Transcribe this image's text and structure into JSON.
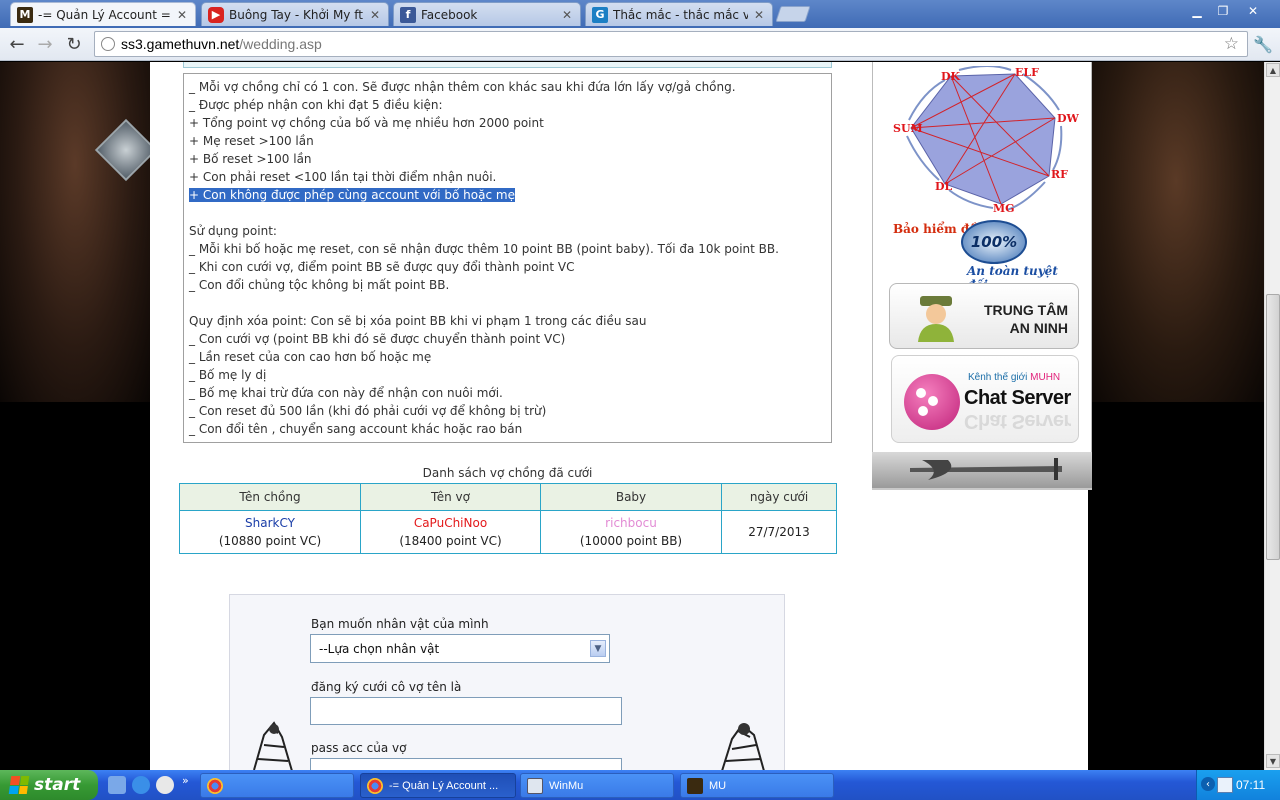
{
  "tabs": [
    {
      "title": "-= Quản Lý Account =-",
      "icon": "mu-game-icon"
    },
    {
      "title": "Buông Tay - Khởi My ft La Thă",
      "icon": "youtube-icon"
    },
    {
      "title": "Facebook",
      "icon": "facebook-icon"
    },
    {
      "title": "Thắc mắc - thắc mắc về poi bé",
      "icon": "gamethu-icon"
    }
  ],
  "toolbar": {
    "url_host": "ss3.gamethuvn.net",
    "url_path": "/wedding.asp"
  },
  "rules": {
    "lines": [
      "_ Mỗi vợ chồng chỉ có 1 con. Sẽ được nhận thêm con khác sau khi đứa lớn lấy vợ/gả chồng.",
      "_ Được phép nhận con khi đạt 5 điều kiện:",
      "+ Tổng point vợ chồng của bố và mẹ nhiều hơn 2000 point",
      "+ Mẹ reset >100 lần",
      "+ Bố reset >100 lần",
      "+ Con phải reset <100 lần tại thời điểm nhận nuôi.",
      "+ Con không được phép cùng account với bố hoặc mẹ",
      "",
      "Sử dụng point:",
      "_ Mỗi khi bố hoặc mẹ reset, con sẽ nhận được thêm 10 point BB (point baby). Tối đa 10k point BB.",
      "_ Khi con cưới vợ, điểm point BB sẽ được quy đổi thành point VC",
      "_ Con đổi chủng tộc không bị mất point BB.",
      "",
      "Quy định xóa point: Con sẽ bị xóa point BB khi vi phạm 1 trong các điều sau",
      "_ Con cưới vợ (point BB khi đó sẽ được chuyển thành point VC)",
      "_ Lần reset của con cao hơn bố hoặc mẹ",
      "_ Bố mẹ ly dị",
      "_ Bố mẹ khai trừ đứa con này để nhận con nuôi mới.",
      "_ Con reset đủ 500 lần (khi đó phải cưới vợ để không bị trừ)",
      "_ Con đổi tên , chuyển sang account khác hoặc rao bán"
    ],
    "highlighted_line": "+ Con không được phép cùng account với bố hoặc mẹ"
  },
  "couples_table": {
    "caption": "Danh sách vợ chồng đã cưới",
    "headers": [
      "Tên chồng",
      "Tên vợ",
      "Baby",
      "ngày cưới"
    ],
    "rows": [
      {
        "husband": "SharkCY",
        "husband_points": "(10880 point VC)",
        "wife": "CaPuChiNoo",
        "wife_points": "(18400 point VC)",
        "baby": "richbocu",
        "baby_points": "(10000 point BB)",
        "date": "27/7/2013"
      }
    ]
  },
  "form": {
    "select_label": "Bạn muốn nhân vật của mình",
    "select_value": "--Lựa chọn nhân vật",
    "partner_label": "đăng ký cưới  cô vợ tên là",
    "pass_label": "pass acc của vợ"
  },
  "sidebar": {
    "classes": [
      "DK",
      "ELF",
      "DW",
      "RF",
      "MG",
      "DL",
      "SUM"
    ],
    "insurance_title": "Bảo hiểm đồ",
    "insurance_badge": "100%",
    "insurance_sub": "An toàn tuyệt đối",
    "security_line1": "TRUNG TÂM",
    "security_line2": "AN NINH",
    "chat_top_prefix": "Kênh thế giới",
    "chat_top_brand": "MUHN",
    "chat_main": "Chat Server"
  },
  "taskbar": {
    "start": "start",
    "tasks": [
      {
        "label": "",
        "icon": "chrome-icon"
      },
      {
        "label": "-= Quản Lý Account ...",
        "icon": "chrome-icon",
        "active": true
      },
      {
        "label": "WinMu",
        "icon": "winmu-icon"
      },
      {
        "label": "MU",
        "icon": "mu-icon"
      }
    ],
    "clock": "07:11"
  },
  "colors": {
    "table_border": "#2aa5c8",
    "highlight": "#316ac5",
    "husband": "#1b3ea8",
    "wife": "#e3191b",
    "baby": "#e28bd4"
  }
}
